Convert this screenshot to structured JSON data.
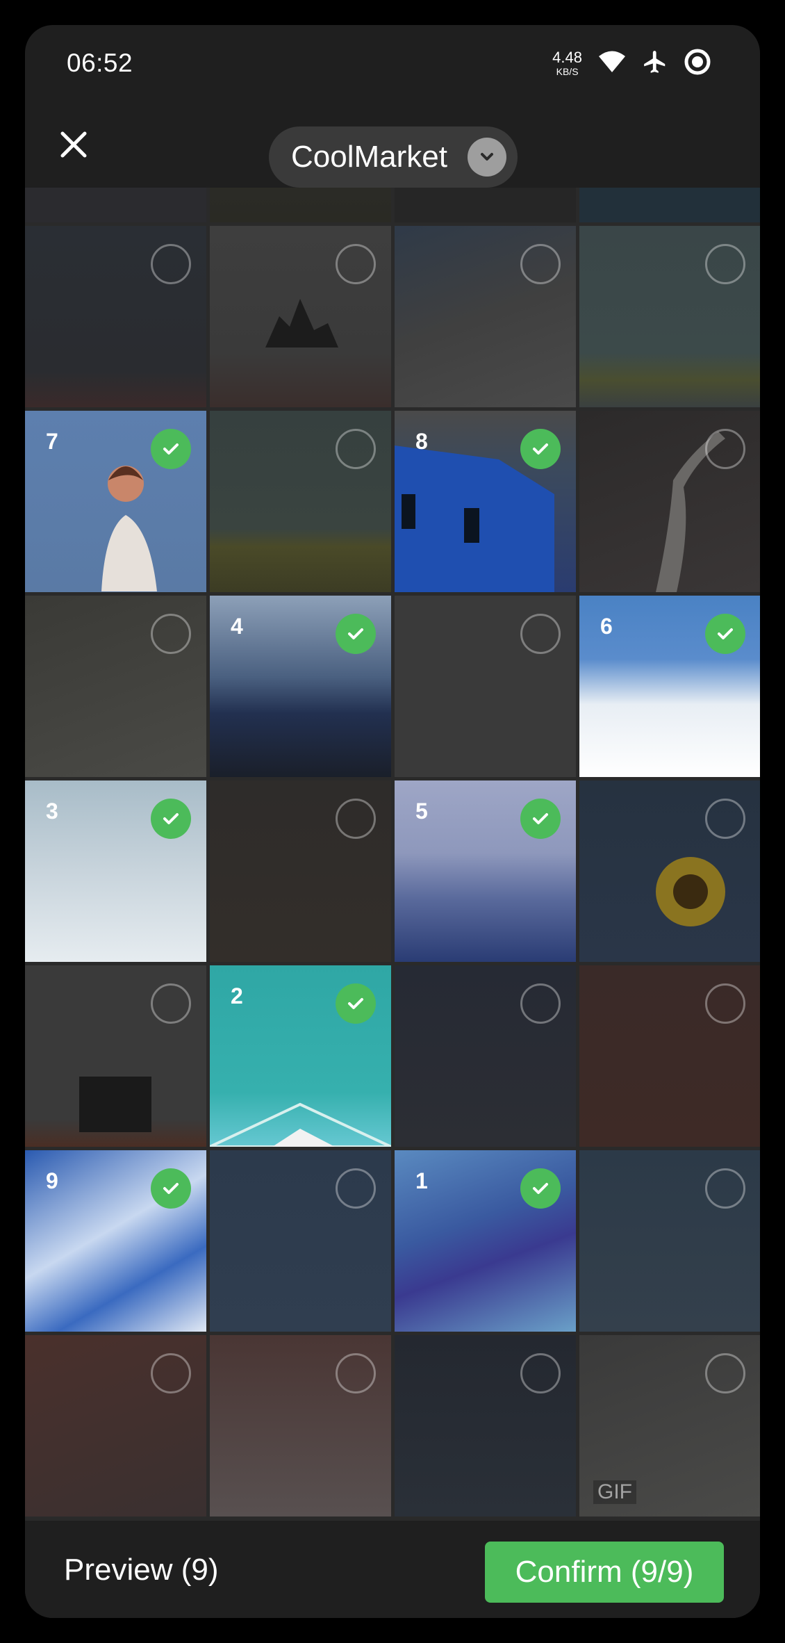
{
  "status_bar": {
    "time": "06:52",
    "net_speed_value": "4.48",
    "net_speed_unit": "KB/S",
    "icons": [
      "wifi-icon",
      "airplane-icon",
      "target-icon"
    ]
  },
  "header": {
    "close_icon": "close-icon",
    "album_name": "CoolMarket",
    "album_chevron_icon": "chevron-down-icon"
  },
  "grid": {
    "cells": [
      {
        "id": "r0c0",
        "num": "",
        "selected": false,
        "gif": ""
      },
      {
        "id": "r0c1",
        "num": "",
        "selected": false,
        "gif": ""
      },
      {
        "id": "r0c2",
        "num": "",
        "selected": false,
        "gif": ""
      },
      {
        "id": "r0c3",
        "num": "",
        "selected": false,
        "gif": ""
      },
      {
        "id": "r1c0",
        "num": "7",
        "selected": true,
        "gif": ""
      },
      {
        "id": "r1c1",
        "num": "",
        "selected": false,
        "gif": ""
      },
      {
        "id": "r1c2",
        "num": "8",
        "selected": true,
        "gif": ""
      },
      {
        "id": "r1c3",
        "num": "",
        "selected": false,
        "gif": ""
      },
      {
        "id": "r2c0",
        "num": "",
        "selected": false,
        "gif": ""
      },
      {
        "id": "r2c1",
        "num": "4",
        "selected": true,
        "gif": ""
      },
      {
        "id": "r2c2",
        "num": "",
        "selected": false,
        "gif": ""
      },
      {
        "id": "r2c3",
        "num": "6",
        "selected": true,
        "gif": ""
      },
      {
        "id": "r3c0",
        "num": "3",
        "selected": true,
        "gif": ""
      },
      {
        "id": "r3c1",
        "num": "",
        "selected": false,
        "gif": ""
      },
      {
        "id": "r3c2",
        "num": "5",
        "selected": true,
        "gif": ""
      },
      {
        "id": "r3c3",
        "num": "",
        "selected": false,
        "gif": ""
      },
      {
        "id": "r4c0",
        "num": "",
        "selected": false,
        "gif": ""
      },
      {
        "id": "r4c1",
        "num": "2",
        "selected": true,
        "gif": ""
      },
      {
        "id": "r4c2",
        "num": "",
        "selected": false,
        "gif": ""
      },
      {
        "id": "r4c3",
        "num": "",
        "selected": false,
        "gif": ""
      },
      {
        "id": "r5c0",
        "num": "9",
        "selected": true,
        "gif": ""
      },
      {
        "id": "r5c1",
        "num": "",
        "selected": false,
        "gif": ""
      },
      {
        "id": "r5c2",
        "num": "1",
        "selected": true,
        "gif": ""
      },
      {
        "id": "r5c3",
        "num": "",
        "selected": false,
        "gif": ""
      },
      {
        "id": "r6c0",
        "num": "",
        "selected": false,
        "gif": ""
      },
      {
        "id": "r6c1",
        "num": "",
        "selected": false,
        "gif": ""
      },
      {
        "id": "r6c2",
        "num": "",
        "selected": false,
        "gif": ""
      },
      {
        "id": "r6c3",
        "num": "",
        "selected": false,
        "gif": "GIF"
      }
    ]
  },
  "bottom_bar": {
    "preview_label": "Preview (9)",
    "confirm_label": "Confirm (9/9)"
  },
  "colors": {
    "accent": "#4cbb5a",
    "background": "#1f1f1f",
    "pill": "#3a3a3a"
  }
}
